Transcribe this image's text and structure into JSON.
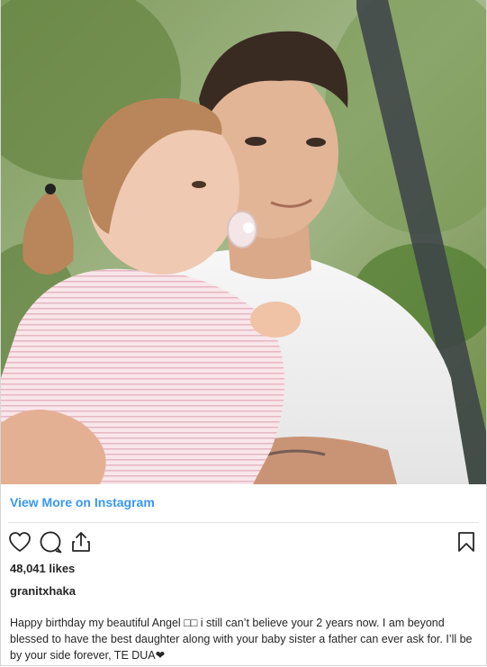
{
  "post": {
    "photo_alt": "",
    "view_more_label": "View More on Instagram",
    "likes": "48,041 likes",
    "username": "granitxhaka",
    "caption": "Happy birthday my beautiful Angel □□ i still can’t believe your 2 years now. I am beyond blessed to have the best daughter along with your baby sister a father can ever ask for. I’ll be by your side forever, TE DUA❤"
  },
  "actions": {
    "like_icon": "heart-icon",
    "comment_icon": "comment-icon",
    "share_icon": "share-icon",
    "save_icon": "bookmark-icon"
  },
  "colors": {
    "link": "#3897f0",
    "text": "#262626",
    "divider": "#e3e3e3"
  }
}
